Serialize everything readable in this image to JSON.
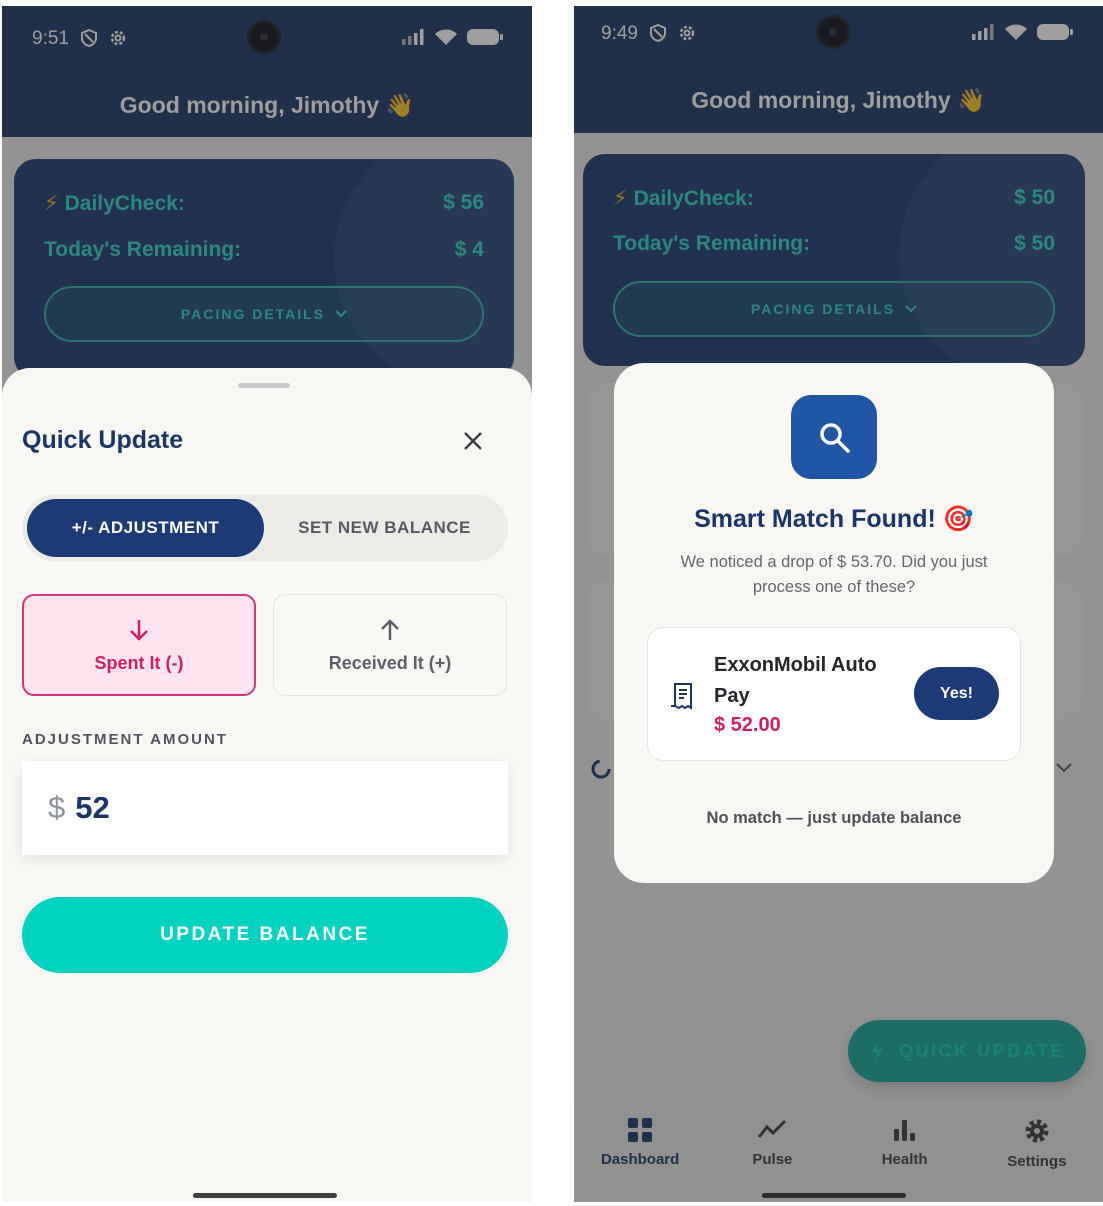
{
  "left_screen": {
    "status": {
      "time": "9:51"
    },
    "greeting": "Good morning, Jimothy 👋",
    "daily_card": {
      "dailycheck_label": "DailyCheck:",
      "dailycheck_value": "$ 56",
      "remaining_label": "Today's Remaining:",
      "remaining_value": "$ 4",
      "pacing_label": "PACING DETAILS"
    },
    "sheet": {
      "title": "Quick Update",
      "segments": [
        "+/- ADJUSTMENT",
        "SET NEW BALANCE"
      ],
      "spent_label": "Spent It (-)",
      "received_label": "Received It (+)",
      "amount_label": "ADJUSTMENT AMOUNT",
      "currency": "$",
      "amount_value": "52",
      "update_button": "UPDATE BALANCE"
    }
  },
  "right_screen": {
    "status": {
      "time": "9:49"
    },
    "greeting": "Good morning, Jimothy 👋",
    "daily_card": {
      "dailycheck_label": "DailyCheck:",
      "dailycheck_value": "$ 50",
      "remaining_label": "Today's Remaining:",
      "remaining_value": "$ 50",
      "pacing_label": "PACING DETAILS"
    },
    "modal": {
      "icon": "search-icon",
      "title": "Smart Match Found! 🎯",
      "text": "We noticed a drop of $ 53.70. Did you just process one of these?",
      "match_name": "ExxonMobil Auto Pay",
      "match_amount": "$ 52.00",
      "yes_button": "Yes!",
      "no_match": "No match — just update balance"
    },
    "fab_label": "QUICK UPDATE",
    "nav": [
      "Dashboard",
      "Pulse",
      "Health",
      "Settings"
    ]
  },
  "colors": {
    "header": "#1b3566",
    "accent_teal": "#00d2c1",
    "spent_pink": "#d01f63",
    "navy_button": "#1c3a75"
  }
}
